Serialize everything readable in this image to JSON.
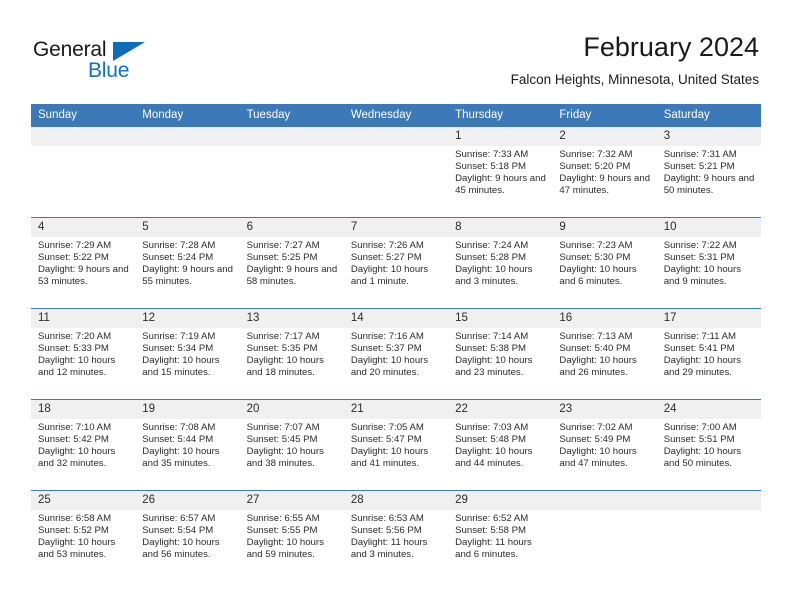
{
  "brand": {
    "name_top": "General",
    "name_bottom": "Blue",
    "flag_icon": "triangle-flag-icon",
    "accent_color": "#1271c0"
  },
  "header": {
    "title": "February 2024",
    "subtitle": "Falcon Heights, Minnesota, United States"
  },
  "theme": {
    "header_row_color": "#3b79b8",
    "daynum_band_color": "#f0f0f0",
    "text_color": "#2b2b2b"
  },
  "weekday_headers": [
    "Sunday",
    "Monday",
    "Tuesday",
    "Wednesday",
    "Thursday",
    "Friday",
    "Saturday"
  ],
  "weeks": [
    [
      {
        "day": "",
        "lines": []
      },
      {
        "day": "",
        "lines": []
      },
      {
        "day": "",
        "lines": []
      },
      {
        "day": "",
        "lines": []
      },
      {
        "day": "1",
        "lines": [
          "Sunrise: 7:33 AM",
          "Sunset: 5:18 PM",
          "Daylight: 9 hours and 45 minutes."
        ]
      },
      {
        "day": "2",
        "lines": [
          "Sunrise: 7:32 AM",
          "Sunset: 5:20 PM",
          "Daylight: 9 hours and 47 minutes."
        ]
      },
      {
        "day": "3",
        "lines": [
          "Sunrise: 7:31 AM",
          "Sunset: 5:21 PM",
          "Daylight: 9 hours and 50 minutes."
        ]
      }
    ],
    [
      {
        "day": "4",
        "lines": [
          "Sunrise: 7:29 AM",
          "Sunset: 5:22 PM",
          "Daylight: 9 hours and 53 minutes."
        ]
      },
      {
        "day": "5",
        "lines": [
          "Sunrise: 7:28 AM",
          "Sunset: 5:24 PM",
          "Daylight: 9 hours and 55 minutes."
        ]
      },
      {
        "day": "6",
        "lines": [
          "Sunrise: 7:27 AM",
          "Sunset: 5:25 PM",
          "Daylight: 9 hours and 58 minutes."
        ]
      },
      {
        "day": "7",
        "lines": [
          "Sunrise: 7:26 AM",
          "Sunset: 5:27 PM",
          "Daylight: 10 hours and 1 minute."
        ]
      },
      {
        "day": "8",
        "lines": [
          "Sunrise: 7:24 AM",
          "Sunset: 5:28 PM",
          "Daylight: 10 hours and 3 minutes."
        ]
      },
      {
        "day": "9",
        "lines": [
          "Sunrise: 7:23 AM",
          "Sunset: 5:30 PM",
          "Daylight: 10 hours and 6 minutes."
        ]
      },
      {
        "day": "10",
        "lines": [
          "Sunrise: 7:22 AM",
          "Sunset: 5:31 PM",
          "Daylight: 10 hours and 9 minutes."
        ]
      }
    ],
    [
      {
        "day": "11",
        "lines": [
          "Sunrise: 7:20 AM",
          "Sunset: 5:33 PM",
          "Daylight: 10 hours and 12 minutes."
        ]
      },
      {
        "day": "12",
        "lines": [
          "Sunrise: 7:19 AM",
          "Sunset: 5:34 PM",
          "Daylight: 10 hours and 15 minutes."
        ]
      },
      {
        "day": "13",
        "lines": [
          "Sunrise: 7:17 AM",
          "Sunset: 5:35 PM",
          "Daylight: 10 hours and 18 minutes."
        ]
      },
      {
        "day": "14",
        "lines": [
          "Sunrise: 7:16 AM",
          "Sunset: 5:37 PM",
          "Daylight: 10 hours and 20 minutes."
        ]
      },
      {
        "day": "15",
        "lines": [
          "Sunrise: 7:14 AM",
          "Sunset: 5:38 PM",
          "Daylight: 10 hours and 23 minutes."
        ]
      },
      {
        "day": "16",
        "lines": [
          "Sunrise: 7:13 AM",
          "Sunset: 5:40 PM",
          "Daylight: 10 hours and 26 minutes."
        ]
      },
      {
        "day": "17",
        "lines": [
          "Sunrise: 7:11 AM",
          "Sunset: 5:41 PM",
          "Daylight: 10 hours and 29 minutes."
        ]
      }
    ],
    [
      {
        "day": "18",
        "lines": [
          "Sunrise: 7:10 AM",
          "Sunset: 5:42 PM",
          "Daylight: 10 hours and 32 minutes."
        ]
      },
      {
        "day": "19",
        "lines": [
          "Sunrise: 7:08 AM",
          "Sunset: 5:44 PM",
          "Daylight: 10 hours and 35 minutes."
        ]
      },
      {
        "day": "20",
        "lines": [
          "Sunrise: 7:07 AM",
          "Sunset: 5:45 PM",
          "Daylight: 10 hours and 38 minutes."
        ]
      },
      {
        "day": "21",
        "lines": [
          "Sunrise: 7:05 AM",
          "Sunset: 5:47 PM",
          "Daylight: 10 hours and 41 minutes."
        ]
      },
      {
        "day": "22",
        "lines": [
          "Sunrise: 7:03 AM",
          "Sunset: 5:48 PM",
          "Daylight: 10 hours and 44 minutes."
        ]
      },
      {
        "day": "23",
        "lines": [
          "Sunrise: 7:02 AM",
          "Sunset: 5:49 PM",
          "Daylight: 10 hours and 47 minutes."
        ]
      },
      {
        "day": "24",
        "lines": [
          "Sunrise: 7:00 AM",
          "Sunset: 5:51 PM",
          "Daylight: 10 hours and 50 minutes."
        ]
      }
    ],
    [
      {
        "day": "25",
        "lines": [
          "Sunrise: 6:58 AM",
          "Sunset: 5:52 PM",
          "Daylight: 10 hours and 53 minutes."
        ]
      },
      {
        "day": "26",
        "lines": [
          "Sunrise: 6:57 AM",
          "Sunset: 5:54 PM",
          "Daylight: 10 hours and 56 minutes."
        ]
      },
      {
        "day": "27",
        "lines": [
          "Sunrise: 6:55 AM",
          "Sunset: 5:55 PM",
          "Daylight: 10 hours and 59 minutes."
        ]
      },
      {
        "day": "28",
        "lines": [
          "Sunrise: 6:53 AM",
          "Sunset: 5:56 PM",
          "Daylight: 11 hours and 3 minutes."
        ]
      },
      {
        "day": "29",
        "lines": [
          "Sunrise: 6:52 AM",
          "Sunset: 5:58 PM",
          "Daylight: 11 hours and 6 minutes."
        ]
      },
      {
        "day": "",
        "lines": []
      },
      {
        "day": "",
        "lines": []
      }
    ]
  ]
}
